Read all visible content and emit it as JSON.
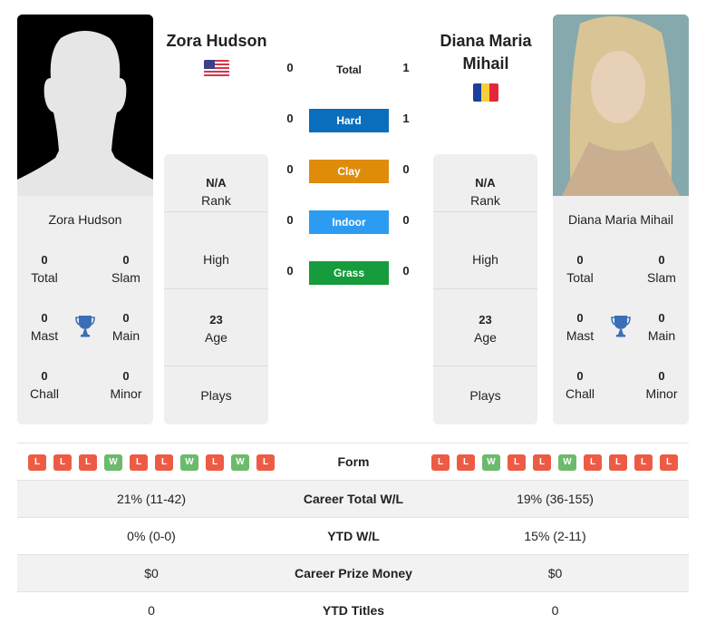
{
  "players": {
    "left": {
      "name": "Zora Hudson",
      "flag": "usa-flag-icon",
      "photo": "silhouette-placeholder",
      "card": {
        "total": "0",
        "total_label": "Total",
        "slam": "0",
        "slam_label": "Slam",
        "mast": "0",
        "mast_label": "Mast",
        "main": "0",
        "main_label": "Main",
        "chall": "0",
        "chall_label": "Chall",
        "minor": "0",
        "minor_label": "Minor"
      },
      "stats": {
        "rank_value": "N/A",
        "rank_label": "Rank",
        "high_label": "High",
        "age_value": "23",
        "age_label": "Age",
        "plays_label": "Plays"
      },
      "form": [
        "L",
        "L",
        "L",
        "W",
        "L",
        "L",
        "W",
        "L",
        "W",
        "L"
      ]
    },
    "right": {
      "name": "Diana Maria Mihail",
      "name_line1": "Diana Maria",
      "name_line2": "Mihail",
      "flag": "romania-flag-icon",
      "photo": "player-photo",
      "card": {
        "total": "0",
        "total_label": "Total",
        "slam": "0",
        "slam_label": "Slam",
        "mast": "0",
        "mast_label": "Mast",
        "main": "0",
        "main_label": "Main",
        "chall": "0",
        "chall_label": "Chall",
        "minor": "0",
        "minor_label": "Minor"
      },
      "stats": {
        "rank_value": "N/A",
        "rank_label": "Rank",
        "high_label": "High",
        "age_value": "23",
        "age_label": "Age",
        "plays_label": "Plays"
      },
      "form": [
        "L",
        "L",
        "W",
        "L",
        "L",
        "W",
        "L",
        "L",
        "L",
        "L"
      ]
    }
  },
  "h2h": {
    "total": {
      "label": "Total",
      "left": "0",
      "right": "1"
    },
    "surfaces": [
      {
        "label": "Hard",
        "left": "0",
        "right": "1",
        "color": "#0a6ebd"
      },
      {
        "label": "Clay",
        "left": "0",
        "right": "0",
        "color": "#e08c0b"
      },
      {
        "label": "Indoor",
        "left": "0",
        "right": "0",
        "color": "#2b9cf2"
      },
      {
        "label": "Grass",
        "left": "0",
        "right": "0",
        "color": "#169c3c"
      }
    ]
  },
  "table": {
    "form_label": "Form",
    "rows": [
      {
        "label": "Career Total W/L",
        "left": "21% (11-42)",
        "right": "19% (36-155)"
      },
      {
        "label": "YTD W/L",
        "left": "0% (0-0)",
        "right": "15% (2-11)"
      },
      {
        "label": "Career Prize Money",
        "left": "$0",
        "right": "$0"
      },
      {
        "label": "YTD Titles",
        "left": "0",
        "right": "0"
      }
    ]
  },
  "colors": {
    "loss": "#ee5b45",
    "win": "#6cba6c",
    "trophy": "#3a6fb8",
    "panel": "#efefef"
  }
}
